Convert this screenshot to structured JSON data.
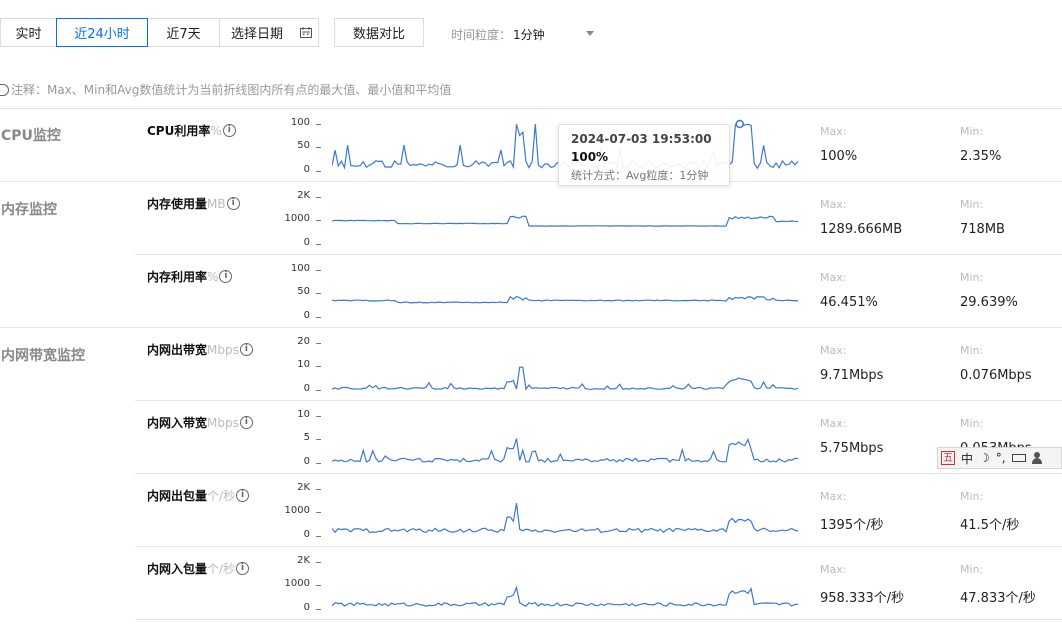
{
  "toolbar": {
    "buttons": [
      "实时",
      "近24小时",
      "近7天"
    ],
    "date_picker": "选择日期",
    "compare": "数据对比",
    "granularity_label": "时间粒度：",
    "granularity_value": "1分钟",
    "accent_color": "#006eff"
  },
  "note": "注释：Max、Min和Avg数值统计为当前折线图内所有点的最大值、最小值和平均值",
  "labels": {
    "max": "Max:",
    "min": "Min:"
  },
  "sections": [
    {
      "title": "CPU监控"
    },
    {
      "title": "内存监控"
    },
    {
      "title": "内网带宽监控"
    }
  ],
  "metrics": [
    {
      "name": "CPU利用率",
      "unit": "%",
      "yticks": [
        "100",
        "50",
        "0"
      ],
      "ymax": 100,
      "max": "100%",
      "min": "2.35%",
      "profile": "cpu"
    },
    {
      "name": "内存使用量",
      "unit": "MB",
      "yticks": [
        "2K",
        "1000",
        "0"
      ],
      "ymax": 2000,
      "max": "1289.666MB",
      "min": "718MB",
      "profile": "memMB"
    },
    {
      "name": "内存利用率",
      "unit": "%",
      "yticks": [
        "100",
        "50",
        "0"
      ],
      "ymax": 100,
      "max": "46.451%",
      "min": "29.639%",
      "profile": "memPct"
    },
    {
      "name": "内网出带宽",
      "unit": "Mbps",
      "yticks": [
        "20",
        "10",
        "0"
      ],
      "ymax": 20,
      "max": "9.71Mbps",
      "min": "0.076Mbps",
      "profile": "bwOut"
    },
    {
      "name": "内网入带宽",
      "unit": "Mbps",
      "yticks": [
        "10",
        "5",
        "0"
      ],
      "ymax": 10,
      "max": "5.75Mbps",
      "min": "0.053Mbps",
      "profile": "bwIn"
    },
    {
      "name": "内网出包量",
      "unit": "个/秒",
      "yticks": [
        "2K",
        "1000",
        "0"
      ],
      "ymax": 2000,
      "max": "1395个/秒",
      "min": "41.5个/秒",
      "profile": "pktOut"
    },
    {
      "name": "内网入包量",
      "unit": "个/秒",
      "yticks": [
        "2K",
        "1000",
        "0"
      ],
      "ymax": 2000,
      "max": "958.333个/秒",
      "min": "47.833个/秒",
      "profile": "pktIn"
    }
  ],
  "tooltip": {
    "time": "2024-07-03 19:53:00",
    "value": "100%",
    "stat": "统计方式：Avg粒度：1分钟"
  },
  "ime": {
    "logo": "五",
    "mode": "中",
    "moon": "☽",
    "punct": "°,",
    "line_color": "#3a78d8"
  }
}
